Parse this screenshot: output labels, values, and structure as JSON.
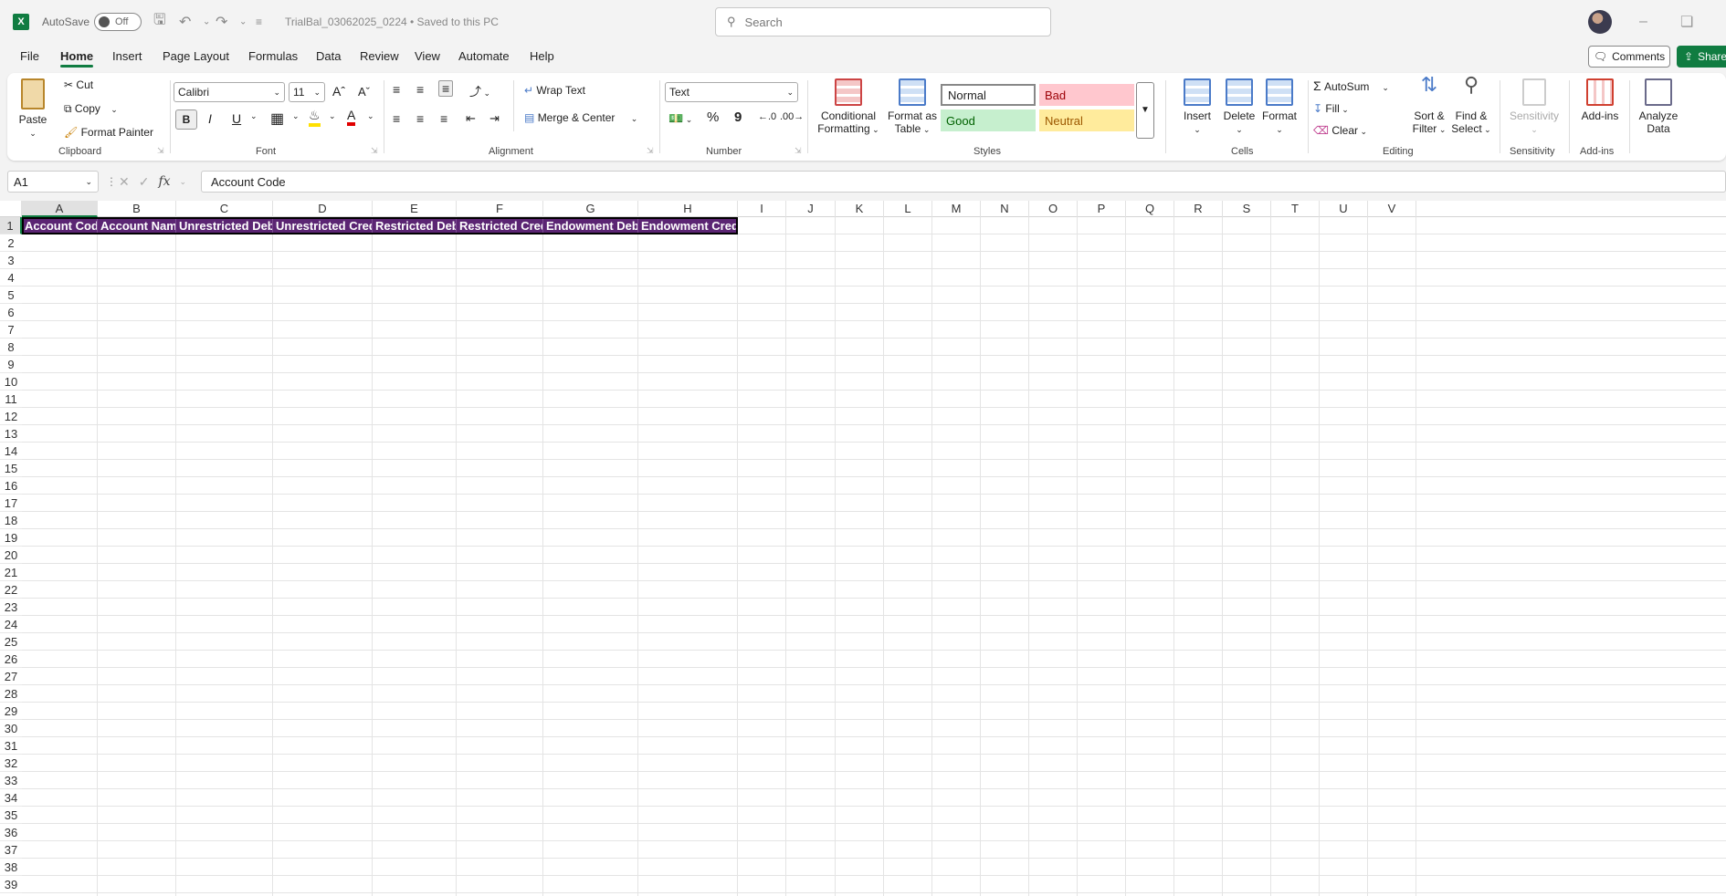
{
  "titlebar": {
    "autosave_label": "AutoSave",
    "autosave_state": "Off",
    "document": "TrialBal_03062025_0224  •  Saved to this PC",
    "search_placeholder": "Search"
  },
  "menu": {
    "tabs": [
      "File",
      "Home",
      "Insert",
      "Page Layout",
      "Formulas",
      "Data",
      "Review",
      "View",
      "Automate",
      "Help"
    ],
    "active": "Home",
    "comments_label": "Comments",
    "share_label": "Share"
  },
  "ribbon": {
    "clipboard": {
      "paste": "Paste",
      "cut": "Cut",
      "copy": "Copy",
      "format_painter": "Format Painter",
      "label": "Clipboard"
    },
    "font": {
      "name": "Calibri",
      "size": "11",
      "label": "Font",
      "bold": "B",
      "italic": "I",
      "underline": "U"
    },
    "alignment": {
      "wrap_text": "Wrap Text",
      "merge_center": "Merge & Center",
      "label": "Alignment"
    },
    "number": {
      "format": "Text",
      "label": "Number",
      "percent": "%",
      "comma": "9"
    },
    "styles": {
      "conditional_line1": "Conditional",
      "conditional_line2": "Formatting",
      "format_table_line1": "Format as",
      "format_table_line2": "Table",
      "normal": "Normal",
      "bad": "Bad",
      "good": "Good",
      "neutral": "Neutral",
      "label": "Styles"
    },
    "cells": {
      "insert": "Insert",
      "delete": "Delete",
      "format": "Format",
      "label": "Cells"
    },
    "editing": {
      "autosum": "AutoSum",
      "fill": "Fill",
      "clear": "Clear",
      "sort_line1": "Sort &",
      "sort_line2": "Filter",
      "find_line1": "Find &",
      "find_line2": "Select",
      "label": "Editing"
    },
    "sensitivity": {
      "button": "Sensitivity",
      "label": "Sensitivity"
    },
    "addins": {
      "button": "Add-ins",
      "label": "Add-ins",
      "analyze_line1": "Analyze",
      "analyze_line2": "Data"
    }
  },
  "formula_bar": {
    "name_box": "A1",
    "fx": "fx",
    "content": "Account Code"
  },
  "sheet": {
    "columns": [
      "A",
      "B",
      "C",
      "D",
      "E",
      "F",
      "G",
      "H",
      "I",
      "J",
      "K",
      "L",
      "M",
      "N",
      "O",
      "P",
      "Q",
      "R",
      "S",
      "T",
      "U",
      "V"
    ],
    "row_count": 39,
    "selected_column": "A",
    "selected_row": 1,
    "header_row": [
      "Account Code",
      "Account Name",
      "Unrestricted Debit",
      "Unrestricted Credit",
      "Restricted Debit",
      "Restricted Credit",
      "Endowment Debit",
      "Endowment Credit"
    ],
    "header_fill": "#5b2573",
    "header_text_color": "#ffffff"
  },
  "colors": {
    "accent": "#107c41",
    "bad_bg": "#ffc7ce",
    "bad_fg": "#9c0006",
    "good_bg": "#c6efce",
    "good_fg": "#006100",
    "neutral_bg": "#ffeb9c",
    "neutral_fg": "#9c5700"
  }
}
